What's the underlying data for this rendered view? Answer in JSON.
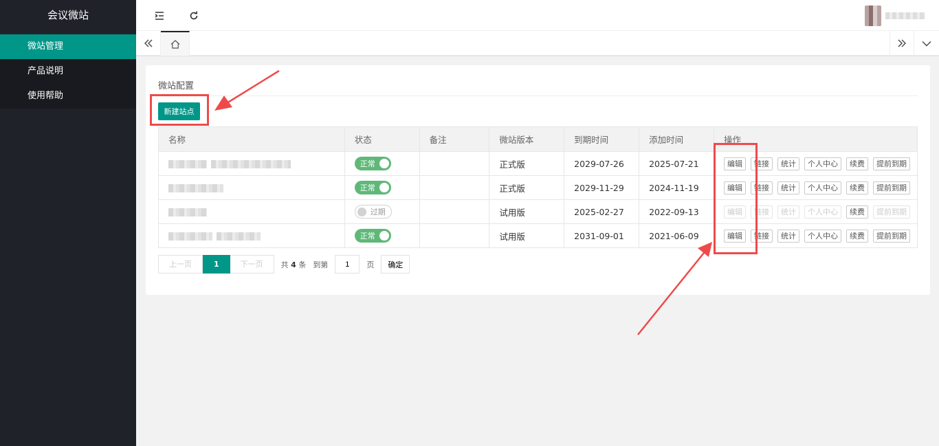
{
  "sidebar": {
    "logo": "会议微站",
    "items": [
      {
        "label": "微站管理",
        "active": true
      },
      {
        "label": "产品说明",
        "active": false
      },
      {
        "label": "使用帮助",
        "active": false
      }
    ]
  },
  "header": {
    "icons": [
      "menu-fold-icon",
      "refresh-icon"
    ]
  },
  "tabs": {
    "icons": [
      "double-left-icon",
      "home-icon",
      "double-right-icon",
      "chevron-down-icon"
    ]
  },
  "card": {
    "title": "微站配置",
    "new_button": "新建站点"
  },
  "table": {
    "headers": [
      "名称",
      "状态",
      "备注",
      "微站版本",
      "到期时间",
      "添加时间",
      "操作"
    ],
    "rows": [
      {
        "status": "正常",
        "status_on": true,
        "version": "正式版",
        "expire": "2029-07-26",
        "added": "2025-07-21"
      },
      {
        "status": "正常",
        "status_on": true,
        "version": "正式版",
        "expire": "2029-11-29",
        "added": "2024-11-19"
      },
      {
        "status": "过期",
        "status_on": false,
        "version": "试用版",
        "expire": "2025-02-27",
        "added": "2022-09-13"
      },
      {
        "status": "正常",
        "status_on": true,
        "version": "试用版",
        "expire": "2031-09-01",
        "added": "2021-06-09"
      }
    ],
    "ops": [
      "编辑",
      "链接",
      "统计",
      "个人中心",
      "续费",
      "提前到期"
    ]
  },
  "pager": {
    "prev": "上一页",
    "current": "1",
    "next": "下一页",
    "total_prefix": "共",
    "total": "4",
    "total_suffix": "条",
    "goto_prefix": "到第",
    "goto_value": "1",
    "goto_suffix": "页",
    "confirm": "确定"
  },
  "colors": {
    "sidebar_bg": "#20222a",
    "accent": "#009688",
    "switch_on": "#5fb878",
    "annotation": "#ef4a4a"
  }
}
